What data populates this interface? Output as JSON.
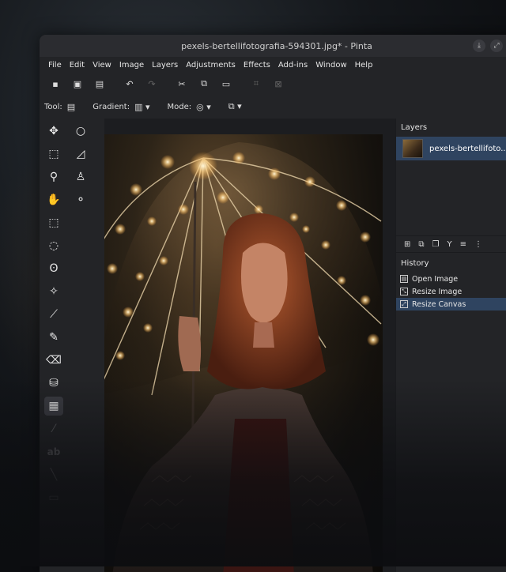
{
  "window": {
    "title": "pexels-bertellifotografia-594301.jpg* - Pinta"
  },
  "menu": [
    "File",
    "Edit",
    "View",
    "Image",
    "Layers",
    "Adjustments",
    "Effects",
    "Add-ins",
    "Window",
    "Help"
  ],
  "options_bar": {
    "tool_label": "Tool:",
    "gradient_label": "Gradient:",
    "mode_label": "Mode:"
  },
  "layers_panel": {
    "title": "Layers",
    "layer_name": "pexels-bertellifoto..."
  },
  "history_panel": {
    "title": "History",
    "items": [
      "Open Image",
      "Resize Image",
      "Resize Canvas"
    ],
    "selected_index": 2
  },
  "icons": {
    "download": "download-icon",
    "maximize": "maximize-icon"
  },
  "colors": {
    "selection": "#2f4460",
    "panel": "#232427"
  }
}
